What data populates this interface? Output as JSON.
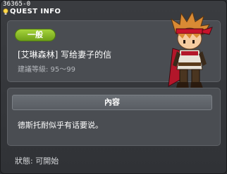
{
  "quest_id": "36365-0",
  "window_title": "QUEST INFO",
  "category_tag": "一般",
  "quest_name": "[艾琳森林] 写给妻子的信",
  "recommended_level": "建議等級: 95～99",
  "content_header": "內容",
  "content_text": "德斯托耐似乎有话要说。",
  "status": "狀態:  可開始",
  "icons": {
    "title": "lightbulb-icon",
    "portrait": "npc-portrait"
  },
  "colors": {
    "tag_green": "#8bc02a",
    "panel": "#4a4d52",
    "background": "#303236"
  }
}
